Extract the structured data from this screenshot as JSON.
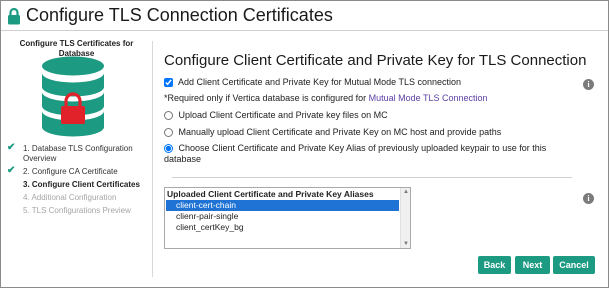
{
  "window": {
    "title": "Configure TLS Connection Certificates"
  },
  "sidebar": {
    "title": "Configure TLS Certificates for Database",
    "steps": [
      {
        "label": "1. Database TLS Configuration Overview",
        "state": "done"
      },
      {
        "label": "2. Configure CA Certificate",
        "state": "done"
      },
      {
        "label": "3. Configure Client Certificates",
        "state": "current"
      },
      {
        "label": "4. Additional Configuration",
        "state": "pending"
      },
      {
        "label": "5. TLS Configurations Preview",
        "state": "pending"
      }
    ],
    "check_glyph": "✔"
  },
  "main": {
    "heading": "Configure Client Certificate and Private Key for TLS Connection",
    "add_client_cert_checkbox": {
      "label": "Add Client Certificate and Private Key for Mutual Mode TLS connection",
      "checked": true
    },
    "required_note": {
      "prefix": "*Required only if Vertica database is configured for ",
      "link": "Mutual Mode TLS Connection"
    },
    "options": [
      {
        "label": "Upload Client Certificate and Private key files on MC",
        "selected": false
      },
      {
        "label": "Manually upload Client Certificate and Private Key on MC host and provide paths",
        "selected": false
      },
      {
        "label": "Choose Client Certificate and Private Key Alias of previously uploaded keypair to use for this",
        "label_line2": "database",
        "selected": true
      }
    ],
    "alias_list": {
      "group_label": "Uploaded Client Certificate and Private Key Aliases",
      "items": [
        {
          "label": "client-cert-chain",
          "selected": true
        },
        {
          "label": "clienr-pair-single",
          "selected": false
        },
        {
          "label": "client_certKey_bg",
          "selected": false
        }
      ]
    },
    "info_icon_glyph": "i"
  },
  "buttons": {
    "back": "Back",
    "next": "Next",
    "cancel": "Cancel"
  },
  "colors": {
    "accent": "#1c9a82",
    "selection": "#1e73d4",
    "link": "#5b3fa5",
    "lock_icon": "#1c9a82",
    "database_icon": "#1c9a82",
    "database_lock": "#e2222b"
  },
  "icons": {
    "title": "lock-icon",
    "database": "database-lock-icon",
    "info": "info-icon",
    "step_done": "check-icon"
  }
}
